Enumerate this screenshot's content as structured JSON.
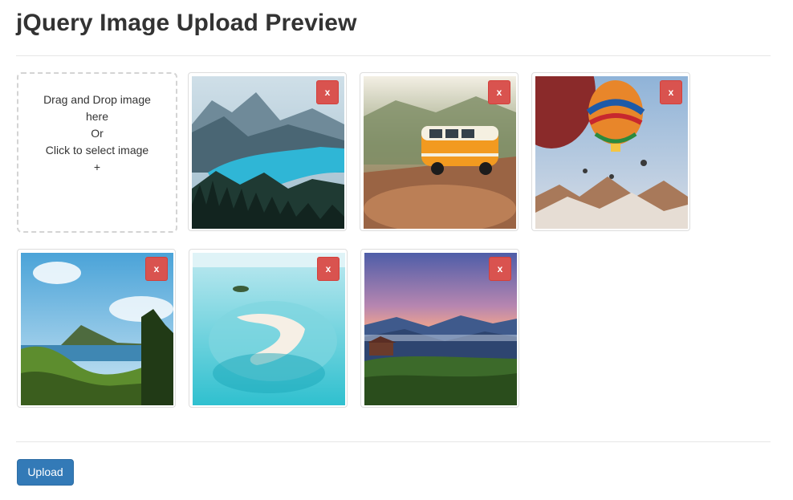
{
  "page": {
    "title": "jQuery Image Upload Preview"
  },
  "dropzone": {
    "line1": "Drag and Drop image",
    "line2": "here",
    "line3": "Or",
    "line4": "Click to select image",
    "line5": "+"
  },
  "images": [
    {
      "name": "lake-mountains",
      "remove_label": "x"
    },
    {
      "name": "orange-van",
      "remove_label": "x"
    },
    {
      "name": "hot-air-balloon",
      "remove_label": "x"
    },
    {
      "name": "coastal-island",
      "remove_label": "x"
    },
    {
      "name": "sandbar-lagoon",
      "remove_label": "x"
    },
    {
      "name": "mountain-sunset",
      "remove_label": "x"
    }
  ],
  "actions": {
    "upload_label": "Upload"
  },
  "colors": {
    "primary": "#337ab7",
    "danger": "#d9534f"
  }
}
